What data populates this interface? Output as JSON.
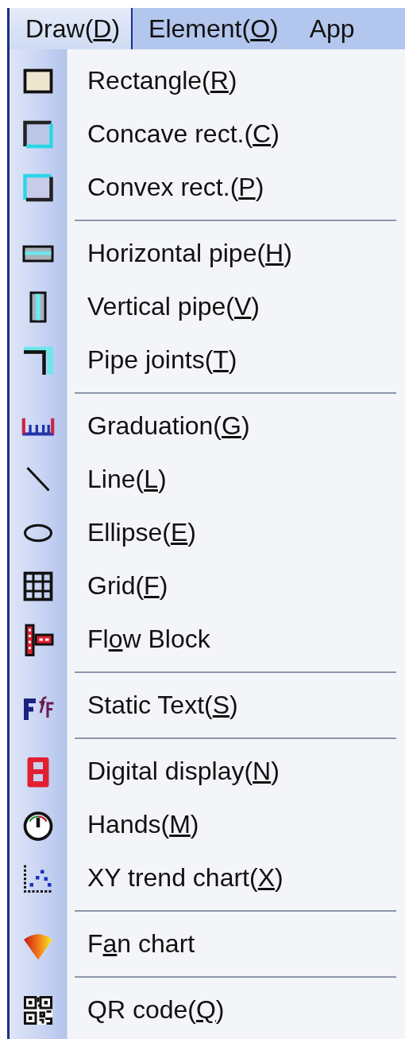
{
  "menu_bar": [
    {
      "label": {
        "before": "Draw(",
        "key": "D",
        "after": ")"
      },
      "selected": true
    },
    {
      "label": {
        "before": "Element(",
        "key": "O",
        "after": ")"
      },
      "selected": false
    },
    {
      "label": {
        "before": "App"
      },
      "selected": false
    }
  ],
  "menu": {
    "items": [
      {
        "kind": "command",
        "label": {
          "before": "Rectangle(",
          "key": "R",
          "after": ")"
        }
      },
      {
        "kind": "command",
        "label": {
          "before": "Concave rect.(",
          "key": "C",
          "after": ")"
        }
      },
      {
        "kind": "command",
        "label": {
          "before": "Convex rect.(",
          "key": "P",
          "after": ")"
        }
      },
      {
        "kind": "separator"
      },
      {
        "kind": "command",
        "label": {
          "before": "Horizontal pipe(",
          "key": "H",
          "after": ")"
        }
      },
      {
        "kind": "command",
        "label": {
          "before": "Vertical pipe(",
          "key": "V",
          "after": ")"
        }
      },
      {
        "kind": "command",
        "label": {
          "before": "Pipe joints(",
          "key": "T",
          "after": ")"
        }
      },
      {
        "kind": "separator"
      },
      {
        "kind": "command",
        "label": {
          "before": "Graduation(",
          "key": "G",
          "after": ")"
        }
      },
      {
        "kind": "command",
        "label": {
          "before": "Line(",
          "key": "L",
          "after": ")"
        }
      },
      {
        "kind": "command",
        "label": {
          "before": "Ellipse(",
          "key": "E",
          "after": ")"
        }
      },
      {
        "kind": "command",
        "label": {
          "before": "Grid(",
          "key": "F",
          "after": ")"
        }
      },
      {
        "kind": "command",
        "label": {
          "before": "Fl",
          "key": "o",
          "after": "w Block"
        }
      },
      {
        "kind": "separator"
      },
      {
        "kind": "command",
        "label": {
          "before": "Static Text(",
          "key": "S",
          "after": ")"
        }
      },
      {
        "kind": "separator"
      },
      {
        "kind": "command",
        "label": {
          "before": "Digital display(",
          "key": "N",
          "after": ")"
        }
      },
      {
        "kind": "command",
        "label": {
          "before": "Hands(",
          "key": "M",
          "after": ")"
        }
      },
      {
        "kind": "command",
        "label": {
          "before": "XY trend chart(",
          "key": "X",
          "after": ")"
        }
      },
      {
        "kind": "separator"
      },
      {
        "kind": "command",
        "label": {
          "before": "F",
          "key": "a",
          "after": "n chart"
        }
      },
      {
        "kind": "separator"
      },
      {
        "kind": "command",
        "label": {
          "before": "QR code(",
          "key": "Q",
          "after": ")"
        }
      }
    ]
  }
}
